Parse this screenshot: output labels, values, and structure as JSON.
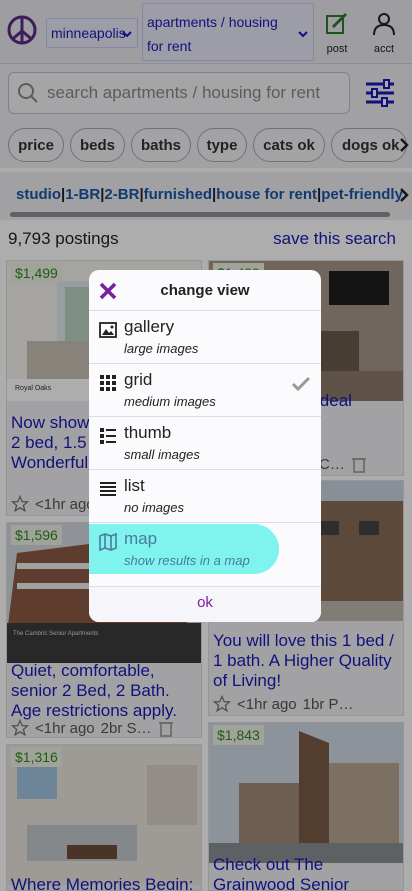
{
  "header": {
    "city": "minneapolis",
    "category": "apartments / housing for rent",
    "post_label": "post",
    "acct_label": "acct",
    "icons": [
      "peace-icon",
      "chevron-down-icon",
      "edit-icon",
      "user-icon"
    ]
  },
  "search": {
    "placeholder": "search apartments / housing for rent"
  },
  "filters": {
    "chips": [
      "price",
      "beds",
      "baths",
      "type",
      "cats ok",
      "dogs ok"
    ]
  },
  "quick_links": {
    "items": [
      "studio",
      "1-BR",
      "2-BR",
      "furnished",
      "house for rent",
      "pet-friendly"
    ]
  },
  "results": {
    "count_text": "9,793 postings",
    "save_search": "save this search"
  },
  "cards": [
    {
      "price": "$1,499",
      "title": "Now showing! Gorgeous 2 bed, 1.5 bath... Wonderful",
      "time": "<1hr ago",
      "extra": "",
      "image_caption": "Royal Oaks"
    },
    {
      "price": "$1,489",
      "title": "elegant! your ideal",
      "time": "",
      "extra": "C…",
      "meta_prefix": "r"
    },
    {
      "price": "$1,596",
      "title": "Quiet, comfortable, senior 2 Bed, 2 Bath. Age restrictions apply.",
      "time": "<1hr ago",
      "extra": "2br  S…",
      "image_caption": "The Cambric Senior Apartments"
    },
    {
      "price": "",
      "title": "You will love this 1 bed / 1 bath. A Higher Quality of Living!",
      "time": "<1hr ago",
      "extra": "1br  P…"
    },
    {
      "price": "$1,316",
      "title": "Where Memories Begin:",
      "time": "",
      "extra": ""
    },
    {
      "price": "$1,843",
      "title": "Check out The Grainwood Senior",
      "time": "",
      "extra": ""
    }
  ],
  "modal": {
    "title": "change view",
    "options": [
      {
        "name": "gallery",
        "sub": "large images",
        "icon": "image-icon"
      },
      {
        "name": "grid",
        "sub": "medium images",
        "icon": "grid-icon",
        "checked": true
      },
      {
        "name": "thumb",
        "sub": "small images",
        "icon": "thumb-list-icon"
      },
      {
        "name": "list",
        "sub": "no images",
        "icon": "list-icon"
      },
      {
        "name": "map",
        "sub": "show results in a map",
        "icon": "map-icon",
        "highlighted": true
      }
    ],
    "ok_label": "ok"
  },
  "colors": {
    "link": "#1a1ab8",
    "price_green": "#2e8a1e",
    "highlight": "#7ff3ee",
    "accent_purple": "#7a1fa2"
  }
}
